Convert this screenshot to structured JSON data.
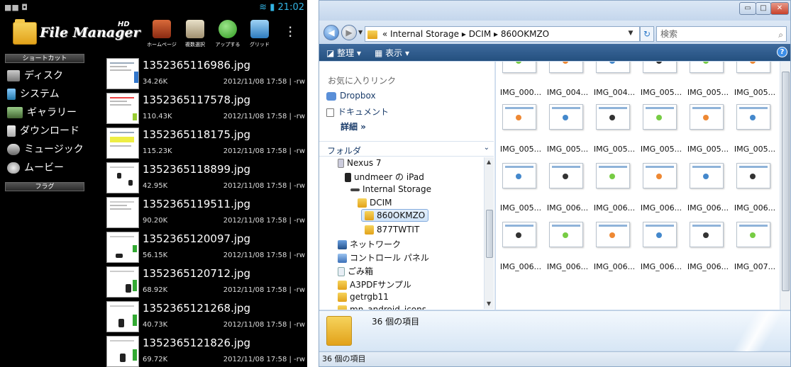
{
  "android": {
    "status": {
      "time": "21:02"
    },
    "logo": {
      "text": "File Manager",
      "badge": "HD"
    },
    "toolbar": [
      {
        "label": "ホームページ",
        "icon": "home-icon"
      },
      {
        "label": "複数選択",
        "icon": "multi-select-icon"
      },
      {
        "label": "アップする",
        "icon": "up-arrow-icon"
      },
      {
        "label": "グリッド",
        "icon": "grid-icon"
      }
    ],
    "sidebar": {
      "shortcut_header": "ショートカット",
      "items": [
        {
          "label": "ディスク",
          "icon": "disk-icon"
        },
        {
          "label": "システム",
          "icon": "system-icon"
        },
        {
          "label": "ギャラリー",
          "icon": "gallery-icon"
        },
        {
          "label": "ダウンロード",
          "icon": "download-icon"
        },
        {
          "label": "ミュージック",
          "icon": "music-icon"
        },
        {
          "label": "ムービー",
          "icon": "movie-icon"
        }
      ],
      "flag_header": "フラグ"
    },
    "files": [
      {
        "name": "1352365116986.jpg",
        "size": "34.26K",
        "date": "2012/11/08 17:58 | -rw"
      },
      {
        "name": "1352365117578.jpg",
        "size": "110.43K",
        "date": "2012/11/08 17:58 | -rw"
      },
      {
        "name": "1352365118175.jpg",
        "size": "115.23K",
        "date": "2012/11/08 17:58 | -rw"
      },
      {
        "name": "1352365118899.jpg",
        "size": "42.95K",
        "date": "2012/11/08 17:58 | -rw"
      },
      {
        "name": "1352365119511.jpg",
        "size": "90.20K",
        "date": "2012/11/08 17:58 | -rw"
      },
      {
        "name": "1352365120097.jpg",
        "size": "56.15K",
        "date": "2012/11/08 17:58 | -rw"
      },
      {
        "name": "1352365120712.jpg",
        "size": "68.92K",
        "date": "2012/11/08 17:58 | -rw"
      },
      {
        "name": "1352365121268.jpg",
        "size": "40.73K",
        "date": "2012/11/08 17:58 | -rw"
      },
      {
        "name": "1352365121826.jpg",
        "size": "69.72K",
        "date": "2012/11/08 17:58 | -rw"
      }
    ]
  },
  "explorer": {
    "address": {
      "prefix": "«",
      "crumbs": [
        "Internal Storage",
        "DCIM",
        "860OKMZO"
      ]
    },
    "search_placeholder": "検索",
    "toolbar": {
      "organize": "整理 ▾",
      "view": "表示 ▾"
    },
    "nav": {
      "favorites_header": "お気に入りリンク",
      "favorites": [
        "Dropbox",
        "ドキュメント"
      ],
      "more": "詳細 »",
      "folder_header": "フォルダ",
      "tree": [
        {
          "label": "Nexus 7",
          "icon": "tablet-icon"
        },
        {
          "label": "undmeer の iPad",
          "icon": "ipad-icon"
        },
        {
          "label": "Internal Storage",
          "icon": "storage-icon"
        },
        {
          "label": "DCIM",
          "icon": "folder-icon"
        },
        {
          "label": "860OKMZO",
          "icon": "folder-icon"
        },
        {
          "label": "877TWTIT",
          "icon": "folder-icon"
        },
        {
          "label": "ネットワーク",
          "icon": "network-icon"
        },
        {
          "label": "コントロール パネル",
          "icon": "control-panel-icon"
        },
        {
          "label": "ごみ箱",
          "icon": "recycle-bin-icon"
        },
        {
          "label": "A3PDFサンプル",
          "icon": "folder-icon"
        },
        {
          "label": "getrgb11",
          "icon": "folder-icon"
        },
        {
          "label": "mn_android_icons",
          "icon": "folder-icon"
        }
      ]
    },
    "grid": [
      [
        "IMG_000...",
        "IMG_004...",
        "IMG_004...",
        "IMG_005...",
        "IMG_005...",
        "IMG_005..."
      ],
      [
        "IMG_005...",
        "IMG_005...",
        "IMG_005...",
        "IMG_005...",
        "IMG_005...",
        "IMG_005..."
      ],
      [
        "IMG_005...",
        "IMG_006...",
        "IMG_006...",
        "IMG_006...",
        "IMG_006...",
        "IMG_006..."
      ],
      [
        "IMG_006...",
        "IMG_006...",
        "IMG_006...",
        "IMG_006...",
        "IMG_006...",
        "IMG_007..."
      ]
    ],
    "details": {
      "count": "36 個の項目"
    },
    "statusbar": {
      "count": "36 個の項目"
    }
  }
}
